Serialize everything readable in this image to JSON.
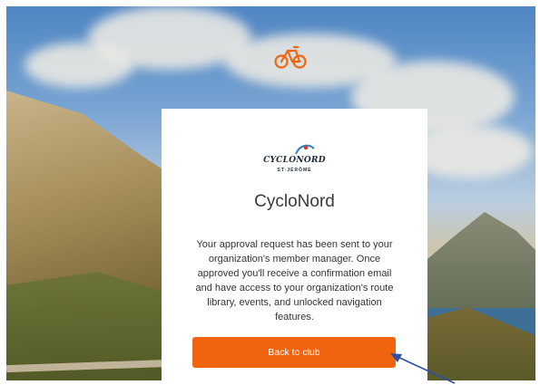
{
  "colors": {
    "accent": "#f1640f",
    "arrow": "#2c4fa8",
    "card_bg": "#ffffff"
  },
  "header": {
    "icon": "bicycle-icon"
  },
  "card": {
    "logo_text": "CYCLONORD",
    "logo_subtext": "ST-JÉRÔME",
    "club_name": "CycloNord",
    "message": "Your approval request has been sent to your organization's member manager. Once approved you'll receive a confirmation email and have access to your organization's route library, events, and unlocked navigation features.",
    "button_label": "Back to club"
  },
  "annotation": {
    "icon": "arrow-icon"
  }
}
